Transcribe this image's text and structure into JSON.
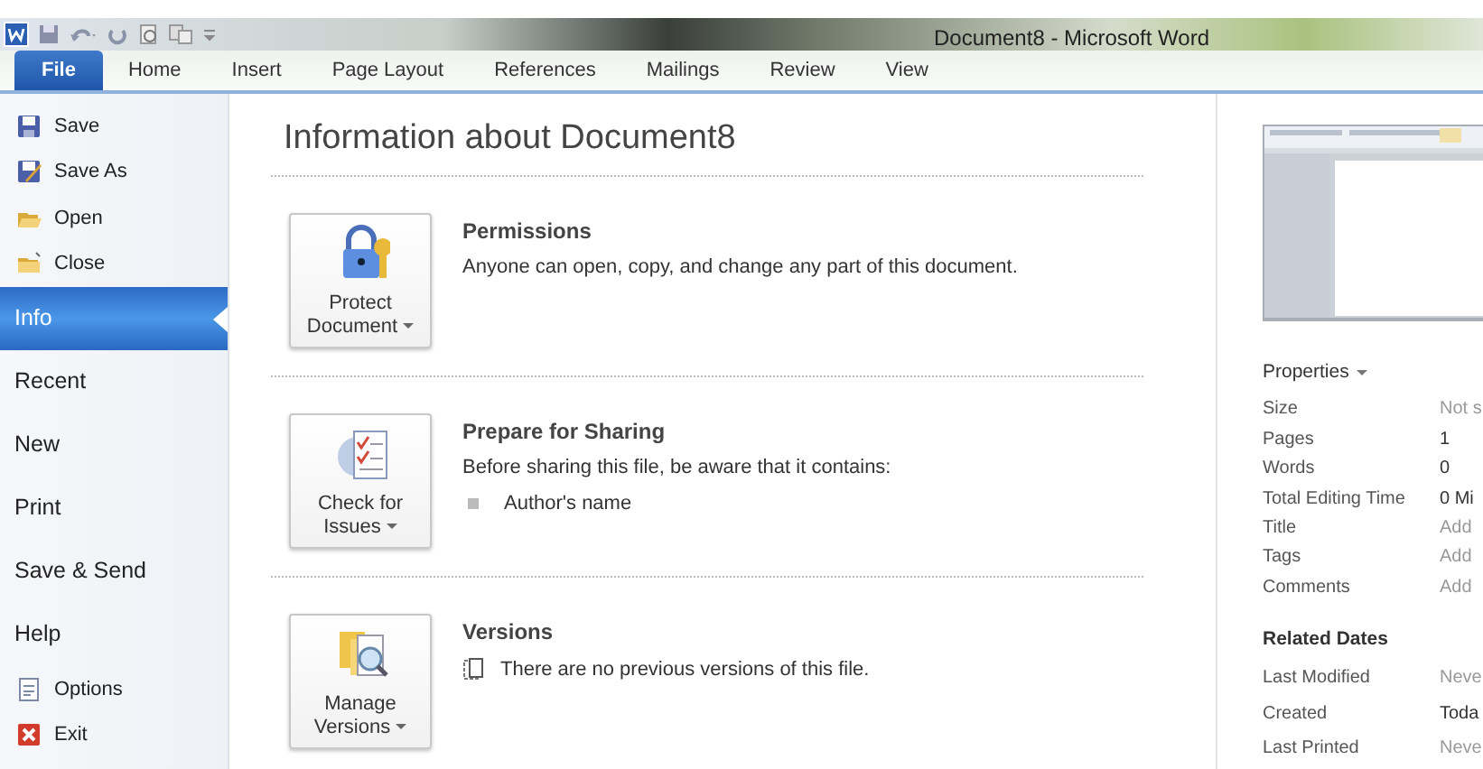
{
  "window": {
    "title": "Document8  -  Microsoft Word"
  },
  "ribbon_tabs": [
    {
      "label": "File",
      "selected": true
    },
    {
      "label": "Home",
      "selected": false
    },
    {
      "label": "Insert",
      "selected": false
    },
    {
      "label": "Page Layout",
      "selected": false
    },
    {
      "label": "References",
      "selected": false
    },
    {
      "label": "Mailings",
      "selected": false
    },
    {
      "label": "Review",
      "selected": false
    },
    {
      "label": "View",
      "selected": false
    }
  ],
  "backstage_menu": [
    {
      "label": "Save",
      "kind": "command",
      "selected": false
    },
    {
      "label": "Save As",
      "kind": "command",
      "selected": false
    },
    {
      "label": "Open",
      "kind": "command",
      "selected": false
    },
    {
      "label": "Close",
      "kind": "command",
      "selected": false
    },
    {
      "label": "Info",
      "kind": "page",
      "selected": true
    },
    {
      "label": "Recent",
      "kind": "page",
      "selected": false
    },
    {
      "label": "New",
      "kind": "page",
      "selected": false
    },
    {
      "label": "Print",
      "kind": "page",
      "selected": false
    },
    {
      "label": "Save & Send",
      "kind": "page",
      "selected": false
    },
    {
      "label": "Help",
      "kind": "page",
      "selected": false
    },
    {
      "label": "Options",
      "kind": "command",
      "selected": false
    },
    {
      "label": "Exit",
      "kind": "command",
      "selected": false
    }
  ],
  "info": {
    "heading": "Information about Document8",
    "sections": [
      {
        "button": [
          "Protect",
          "Document"
        ],
        "title": "Permissions",
        "description": "Anyone can open, copy, and change any part of this document."
      },
      {
        "button": [
          "Check for",
          "Issues"
        ],
        "title": "Prepare for Sharing",
        "description": "Before sharing this file, be aware that it contains:",
        "bullets": [
          "Author's name"
        ]
      },
      {
        "button": [
          "Manage",
          "Versions"
        ],
        "title": "Versions",
        "note": "There are no previous versions of this file."
      }
    ]
  },
  "properties": {
    "heading": "Properties",
    "rows": [
      {
        "name": "Size",
        "value": "Not s",
        "muted": true
      },
      {
        "name": "Pages",
        "value": "1",
        "muted": false
      },
      {
        "name": "Words",
        "value": "0",
        "muted": false
      },
      {
        "name": "Total Editing Time",
        "value": "0 Mi",
        "muted": false
      },
      {
        "name": "Title",
        "value": "Add",
        "muted": true
      },
      {
        "name": "Tags",
        "value": "Add",
        "muted": true
      },
      {
        "name": "Comments",
        "value": "Add",
        "muted": true
      }
    ]
  },
  "related_dates": {
    "heading": "Related Dates",
    "rows": [
      {
        "name": "Last Modified",
        "value": "Neve",
        "muted": true
      },
      {
        "name": "Created",
        "value": "Toda",
        "muted": false
      },
      {
        "name": "Last Printed",
        "value": "Neve",
        "muted": true
      }
    ]
  }
}
